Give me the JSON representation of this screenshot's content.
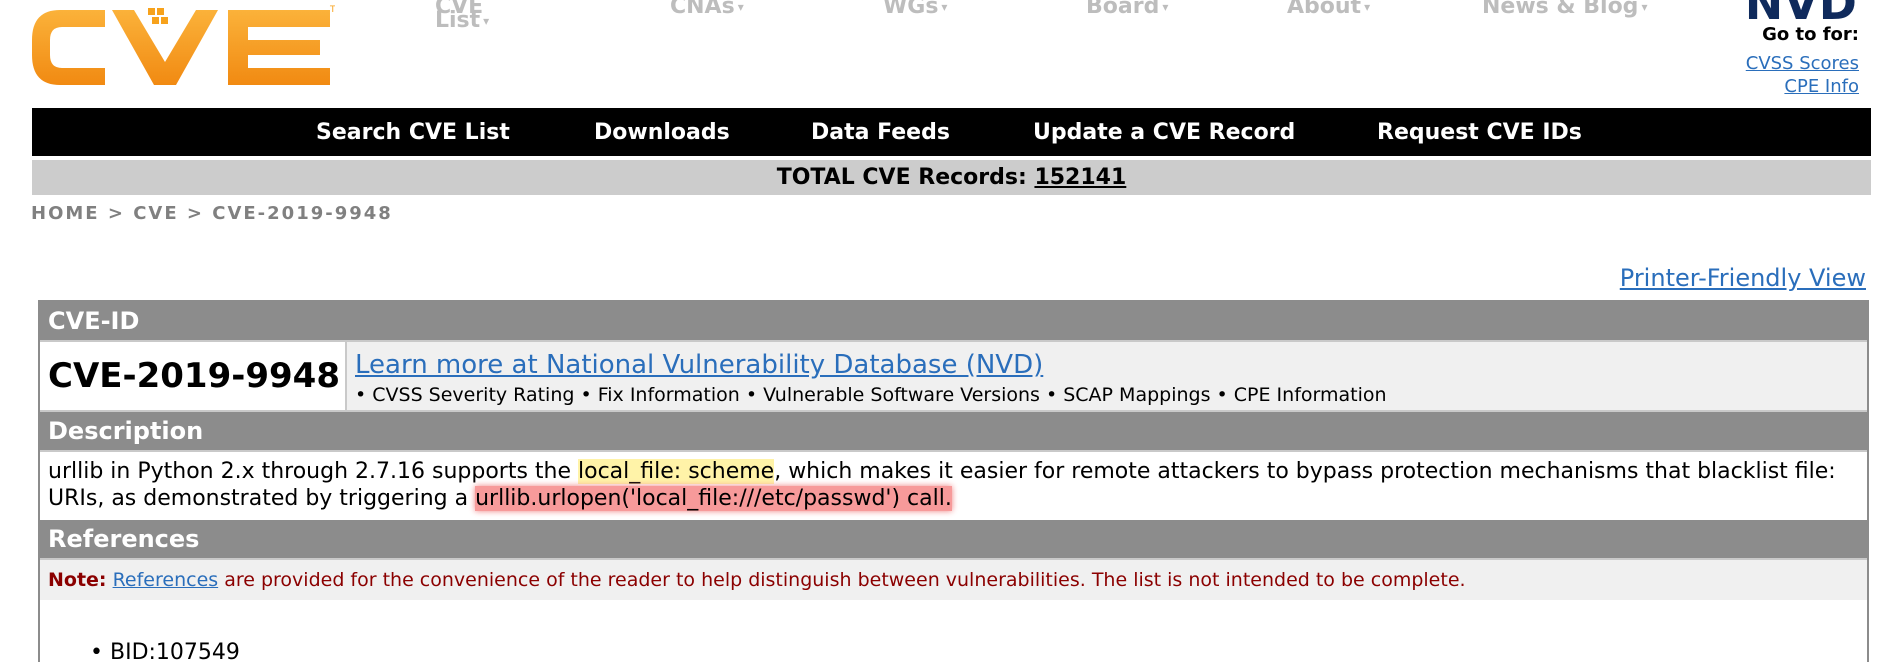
{
  "logo": {
    "text": "CVE",
    "trademark": "TM",
    "color": "#f7a21b"
  },
  "top_nav": [
    {
      "label": "CVE List"
    },
    {
      "label": "CNAs"
    },
    {
      "label": "WGs"
    },
    {
      "label": "Board"
    },
    {
      "label": "About"
    },
    {
      "label": "News & Blog"
    }
  ],
  "nvd": {
    "logo_text": "NVD",
    "goto_label": "Go to for:",
    "links": [
      "CVSS Scores",
      "CPE Info"
    ]
  },
  "main_nav": [
    "Search CVE List",
    "Downloads",
    "Data Feeds",
    "Update a CVE Record",
    "Request CVE IDs"
  ],
  "total_records": {
    "label": "TOTAL CVE Records:",
    "count": "152141"
  },
  "breadcrumb": "HOME > CVE > CVE-2019-9948",
  "printer_link": "Printer-Friendly View",
  "cve_id_section": {
    "header": "CVE-ID",
    "id": "CVE-2019-9948",
    "nvd_link": "Learn more at National Vulnerability Database (NVD)",
    "nvd_features": "• CVSS Severity Rating • Fix Information • Vulnerable Software Versions • SCAP Mappings • CPE Information"
  },
  "description": {
    "header": "Description",
    "text_1": "urllib in Python 2.x through 2.7.16 supports the ",
    "highlight_1": "local_file: scheme",
    "text_2": ", which makes it easier for remote attackers to bypass protection mechanisms that blacklist file: URIs, as demonstrated by triggering a ",
    "highlight_2": "urllib.urlopen('local_file:///etc/passwd') call."
  },
  "references": {
    "header": "References",
    "note_label": "Note:",
    "note_link": "References",
    "note_text": " are provided for the convenience of the reader to help distinguish between vulnerabilities. The list is not intended to be complete.",
    "items": [
      "BID:107549"
    ]
  },
  "colors": {
    "nav_bar": "#000000",
    "count_bar": "#cccccc",
    "section_header": "#8c8c8c",
    "link": "#2a6ebb",
    "note": "#8b0000",
    "highlight_yellow": "#fff3a8",
    "highlight_red": "#f79a9a"
  }
}
